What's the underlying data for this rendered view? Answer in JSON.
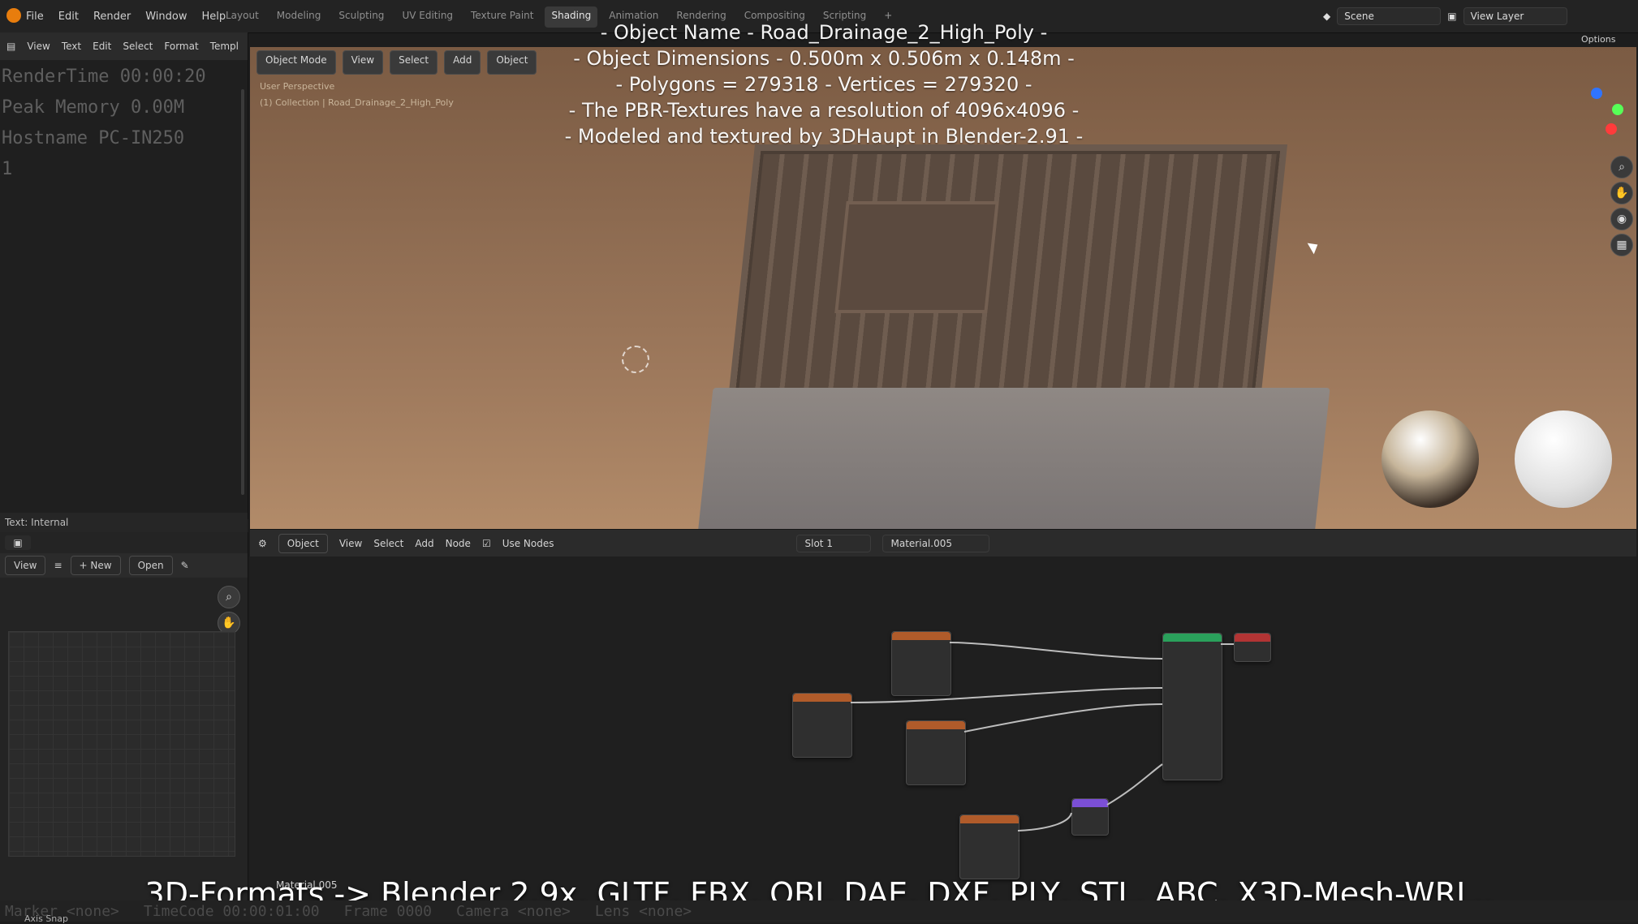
{
  "menu": [
    "File",
    "Edit",
    "Render",
    "Window",
    "Help"
  ],
  "workspaces": [
    "Layout",
    "Modeling",
    "Sculpting",
    "UV Editing",
    "Texture Paint",
    "Shading",
    "Animation",
    "Rendering",
    "Compositing",
    "Scripting"
  ],
  "active_workspace": "Shading",
  "scene": {
    "label": "Scene",
    "view_layer": "View Layer"
  },
  "text_editor": {
    "menu": [
      "View",
      "Text",
      "Edit",
      "Select",
      "Format",
      "Templ"
    ],
    "lines": [
      "RenderTime 00:00:20",
      "Peak Memory 0.00M",
      "Hostname PC-IN250",
      "1"
    ],
    "status": "Text: Internal"
  },
  "image_editor": {
    "view_label": "View",
    "new_label": "+ New",
    "open_label": "Open"
  },
  "viewport": {
    "mode_label": "Object Mode",
    "menu": [
      "View",
      "Select",
      "Add",
      "Object"
    ],
    "persp_label": "User Perspective",
    "collection_label": "(1) Collection | Road_Drainage_2_High_Poly",
    "options_label": "Options"
  },
  "overlay": {
    "line1": "- Object Name - Road_Drainage_2_High_Poly -",
    "line2": "- Object Dimensions - 0.500m x 0.506m x 0.148m -",
    "line3": "- Polygons = 279318 - Vertices = 279320 -",
    "line4": "- The PBR-Textures have a resolution of 4096x4096 -",
    "line5": "- Modeled and textured by 3DHaupt in Blender-2.91 -"
  },
  "node_editor": {
    "object_label": "Object",
    "menu": [
      "View",
      "Select",
      "Add",
      "Node"
    ],
    "use_nodes_label": "Use Nodes",
    "slot_label": "Slot 1",
    "material_label": "Material.005",
    "bottom_material": "Material.005"
  },
  "bottom_caption": "3D-Formats -> Blender 2.9x, GLTF, FBX, OBJ, DAE, DXF, PLY, STL, ABC, X3D-Mesh-WRL..",
  "status_bar": [
    "Marker <none>",
    "TimeCode 00:00:01:00",
    "Frame 0000",
    "Camera <none>",
    "Lens <none>"
  ],
  "axis_snap_label": "Axis Snap"
}
